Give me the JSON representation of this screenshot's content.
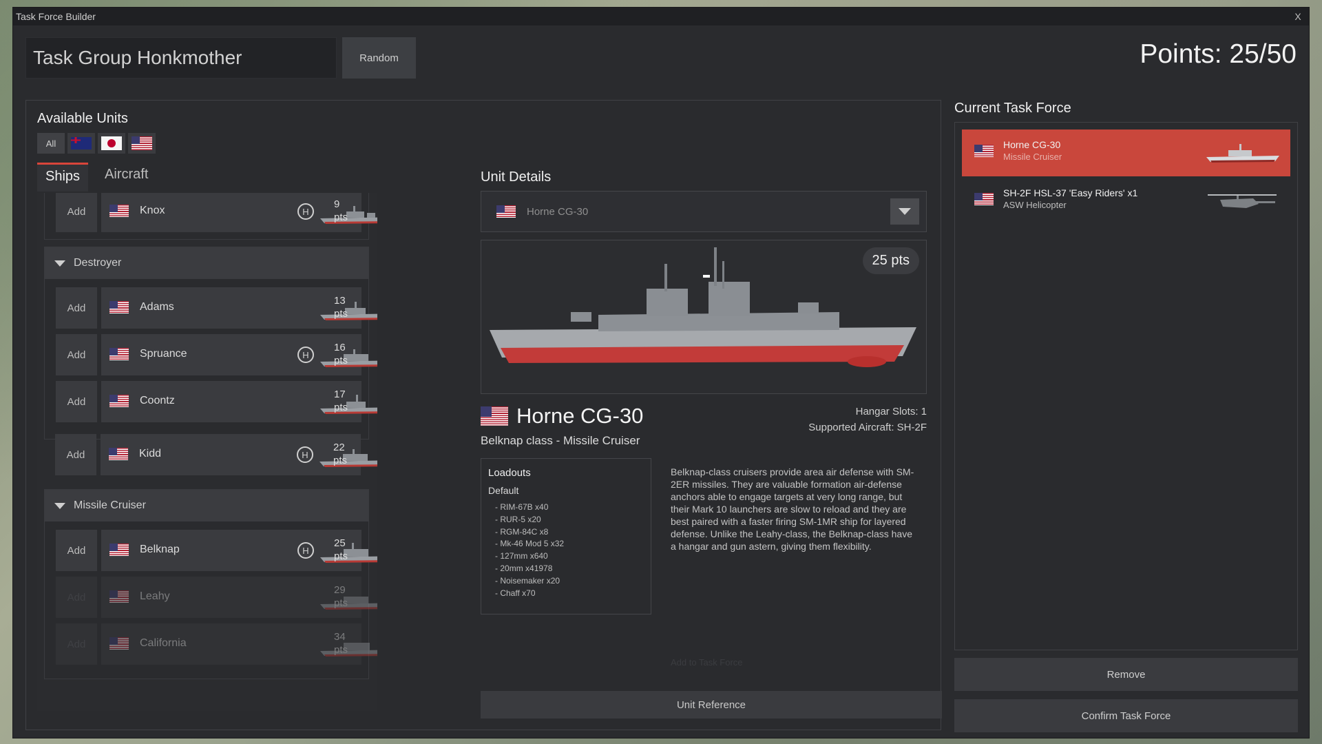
{
  "window": {
    "title": "Task Force Builder",
    "close_label": "X"
  },
  "task_group": {
    "name": "Task Group Honkmother",
    "random_label": "Random"
  },
  "points": {
    "label": "Points: 25/50",
    "used": 25,
    "max": 50
  },
  "available": {
    "title": "Available Units",
    "filters": [
      {
        "label": "All"
      },
      {
        "flag": "au-flag"
      },
      {
        "flag": "jp-flag"
      },
      {
        "flag": "us-flag"
      }
    ],
    "tabs": [
      {
        "label": "Ships",
        "active": true
      },
      {
        "label": "Aircraft",
        "active": false
      }
    ],
    "top_unit": {
      "add": "Add",
      "name": "Knox",
      "pts": "9",
      "pts_unit": "pts",
      "hangar": "H"
    },
    "groups": [
      {
        "name": "Destroyer",
        "units": [
          {
            "add": "Add",
            "name": "Adams",
            "pts": "13",
            "pts_unit": "pts",
            "hangar": ""
          },
          {
            "add": "Add",
            "name": "Spruance",
            "pts": "16",
            "pts_unit": "pts",
            "hangar": "H"
          },
          {
            "add": "Add",
            "name": "Coontz",
            "pts": "17",
            "pts_unit": "pts",
            "hangar": ""
          },
          {
            "add": "Add",
            "name": "Kidd",
            "pts": "22",
            "pts_unit": "pts",
            "hangar": "H"
          }
        ]
      },
      {
        "name": "Missile Cruiser",
        "units": [
          {
            "add": "Add",
            "name": "Belknap",
            "pts": "25",
            "pts_unit": "pts",
            "hangar": "H"
          },
          {
            "add": "Add",
            "name": "Leahy",
            "pts": "29",
            "pts_unit": "pts",
            "hangar": ""
          },
          {
            "add": "Add",
            "name": "California",
            "pts": "34",
            "pts_unit": "pts",
            "hangar": ""
          }
        ]
      }
    ]
  },
  "details": {
    "title": "Unit Details",
    "selected": "Horne CG-30",
    "pts_badge": "25 pts",
    "ship_name": "Horne CG-30",
    "ship_class": "Belknap class - Missile Cruiser",
    "hangar_slots": "Hangar Slots: 1",
    "supported_aircraft": "Supported Aircraft: SH-2F",
    "loadouts_title": "Loadouts",
    "loadout_default": "Default",
    "loadout_items": [
      "RIM-67B x40",
      "RUR-5 x20",
      "RGM-84C x8",
      "Mk-46 Mod 5 x32",
      "127mm x640",
      "20mm x41978",
      "Noisemaker x20",
      "Chaff x70"
    ],
    "description": "Belknap-class cruisers provide area air defense with SM-2ER missiles. They are valuable formation air-defense anchors able to engage targets at very long range, but their Mark 10 launchers are slow to reload and they are best paired with a faster firing SM-1MR ship for layered defense. Unlike the Leahy-class, the Belknap-class have a hangar and gun astern, giving them flexibility.",
    "add_to_task_force": "Add to Task Force",
    "unit_reference": "Unit Reference"
  },
  "task_force": {
    "title": "Current Task Force",
    "items": [
      {
        "name": "Horne CG-30",
        "sub": "Missile Cruiser",
        "count": "",
        "selected": true
      },
      {
        "name": "SH-2F HSL-37 'Easy Riders'",
        "sub": "ASW Helicopter",
        "count": "x1",
        "selected": false
      }
    ],
    "remove_label": "Remove",
    "confirm_label": "Confirm Task Force"
  }
}
